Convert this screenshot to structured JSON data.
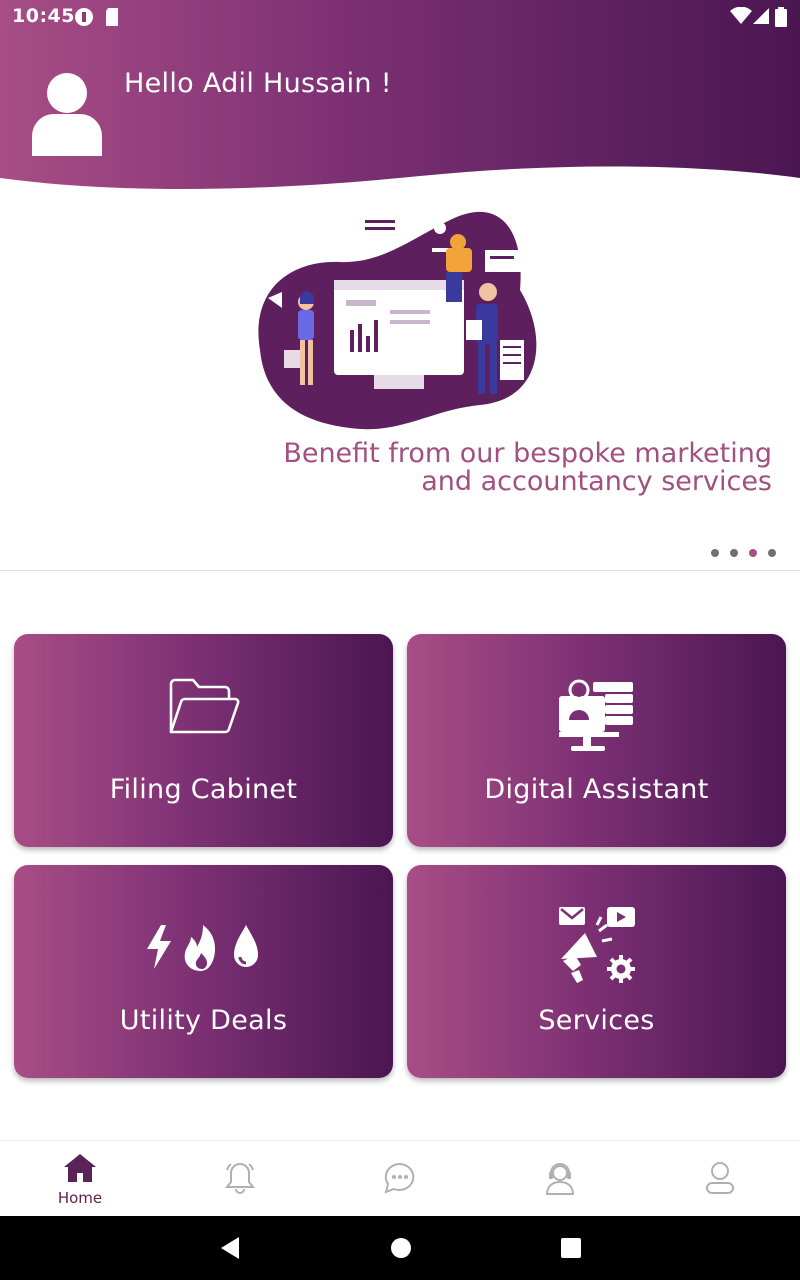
{
  "status_bar": {
    "time": "10:45"
  },
  "header": {
    "greeting": "Hello Adil Hussain !"
  },
  "carousel": {
    "tagline_line1": "Benefit from our bespoke marketing",
    "tagline_line2": "and accountancy services",
    "page_count": 4,
    "active_page": 3
  },
  "tiles": [
    {
      "label": "Filing Cabinet",
      "icon": "folder-icon"
    },
    {
      "label": "Digital Assistant",
      "icon": "digital-assistant-icon"
    },
    {
      "label": "Utility Deals",
      "icon": "utility-icon"
    },
    {
      "label": "Services",
      "icon": "services-icon"
    }
  ],
  "bottom_nav": [
    {
      "label": "Home",
      "icon": "home-icon",
      "active": true
    },
    {
      "label": "",
      "icon": "bell-icon",
      "active": false
    },
    {
      "label": "",
      "icon": "chat-icon",
      "active": false
    },
    {
      "label": "",
      "icon": "support-agent-icon",
      "active": false
    },
    {
      "label": "",
      "icon": "profile-icon",
      "active": false
    }
  ],
  "colors": {
    "gradient_start": "#a84d86",
    "gradient_end": "#4a1652",
    "accent_text": "#a2507f",
    "nav_active": "#5a2358",
    "nav_inactive": "#b0b0b0"
  }
}
